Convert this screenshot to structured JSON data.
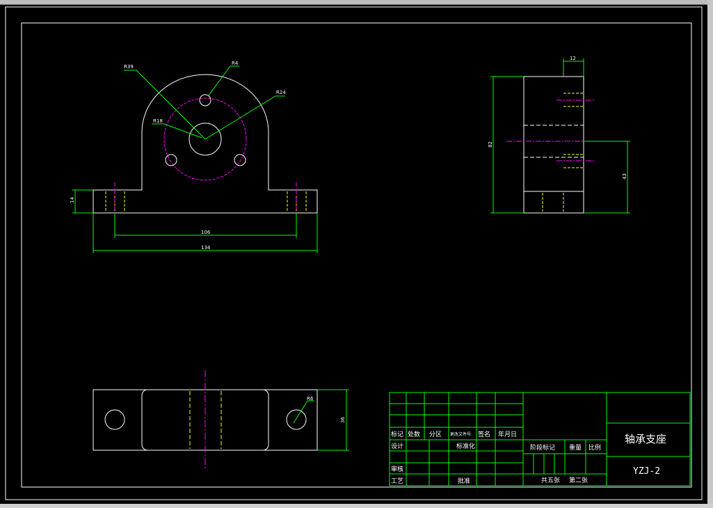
{
  "colors": {
    "background": "#000000",
    "outline": "#ffffff",
    "dimension": "#00ff00",
    "centerline": "#ff00ff",
    "hidden": "#ffff00"
  },
  "front_view": {
    "radius_labels": [
      "R39",
      "R4",
      "R24",
      "R18"
    ],
    "dim_height": "14",
    "dim_hole_spacing": "106",
    "dim_total_width": "134"
  },
  "side_view": {
    "dim_width": "12",
    "dim_height": "82",
    "dim_center_height": "43"
  },
  "top_view": {
    "radius_label": "R6",
    "dim_depth": "36"
  },
  "title_block": {
    "header_labels": [
      "标记",
      "处数",
      "分区",
      "更改文件号",
      "签名",
      "年月日"
    ],
    "design": "设计",
    "standardize": "标准化",
    "review": "审核",
    "process": "工艺",
    "approve": "批准",
    "stage_mark": "阶段标记",
    "weight": "重量",
    "scale": "比例",
    "sheets_total": "共五张",
    "sheet_no": "第二张",
    "part_name": "轴承支座",
    "drawing_no": "YZJ-2"
  }
}
